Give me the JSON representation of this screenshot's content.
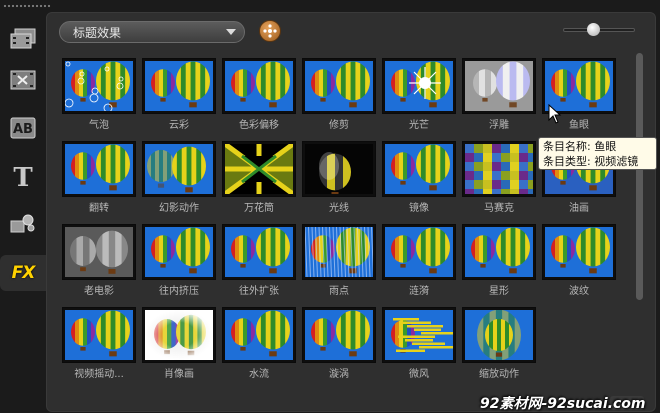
{
  "toolbar": {
    "dropdown_value": "标题效果",
    "zoom_slider_fraction": 0.35
  },
  "sidebar": {
    "items": [
      {
        "icon": "media-library-icon",
        "active": false
      },
      {
        "icon": "transition-icon",
        "active": false
      },
      {
        "icon": "ab-title-icon",
        "active": false
      },
      {
        "icon": "text-t-icon",
        "active": false
      },
      {
        "icon": "graphics-icon",
        "active": false
      },
      {
        "icon": "fx-filter-icon",
        "label": "FX",
        "active": true
      }
    ],
    "t_glyph": "T"
  },
  "effects": [
    {
      "label": "气泡",
      "style": "bubble"
    },
    {
      "label": "云彩",
      "style": "cloud"
    },
    {
      "label": "色彩偏移",
      "style": "shift"
    },
    {
      "label": "修剪",
      "style": "trim"
    },
    {
      "label": "光芒",
      "style": "sparkle"
    },
    {
      "label": "浮雕",
      "style": "emboss"
    },
    {
      "label": "鱼眼",
      "style": "fisheye"
    },
    {
      "label": "翻转",
      "style": "flip"
    },
    {
      "label": "幻影动作",
      "style": "ghost"
    },
    {
      "label": "万花筒",
      "style": "kaleido"
    },
    {
      "label": "光线",
      "style": "light"
    },
    {
      "label": "镜像",
      "style": "mirror"
    },
    {
      "label": "马赛克",
      "style": "mosaic"
    },
    {
      "label": "油画",
      "style": "oil"
    },
    {
      "label": "老电影",
      "style": "oldfilm"
    },
    {
      "label": "往内挤压",
      "style": "pinch"
    },
    {
      "label": "往外扩张",
      "style": "bulge"
    },
    {
      "label": "雨点",
      "style": "rain"
    },
    {
      "label": "涟漪",
      "style": "ripple"
    },
    {
      "label": "星形",
      "style": "star"
    },
    {
      "label": "波纹",
      "style": "wave"
    },
    {
      "label": "视频摇动...",
      "style": "pan"
    },
    {
      "label": "肖像画",
      "style": "portrait"
    },
    {
      "label": "水流",
      "style": "water"
    },
    {
      "label": "漩涡",
      "style": "whirl"
    },
    {
      "label": "微风",
      "style": "wind"
    },
    {
      "label": "缩放动作",
      "style": "zoom"
    }
  ],
  "tooltip": {
    "line1": "条目名称: 鱼眼",
    "line2": "条目类型: 视频滤镜"
  },
  "colors": {
    "accent": "#ffd200",
    "sky": "#1e6fd8",
    "balloon_yellow": "#e6d21a",
    "balloon_green": "#2e8b2a"
  },
  "watermark": "92素材网-92sucai.com"
}
